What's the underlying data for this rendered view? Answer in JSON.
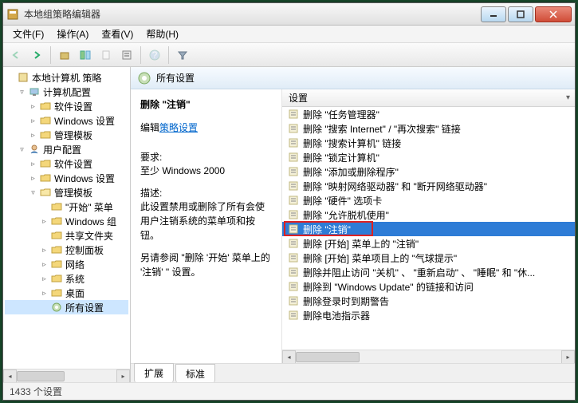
{
  "window": {
    "title": "本地组策略编辑器"
  },
  "menu": {
    "file": "文件(F)",
    "action": "操作(A)",
    "view": "查看(V)",
    "help": "帮助(H)"
  },
  "tree": {
    "root": "本地计算机 策略",
    "computer_config": "计算机配置",
    "software_settings": "软件设置",
    "windows_settings": "Windows 设置",
    "admin_templates": "管理模板",
    "user_config": "用户配置",
    "software_settings2": "软件设置",
    "windows_settings2": "Windows 设置",
    "admin_templates2": "管理模板",
    "start_menu": "\"开始\" 菜单",
    "windows_group": "Windows 组",
    "shared_folders": "共享文件夹",
    "control_panel": "控制面板",
    "network": "网络",
    "system": "系统",
    "desktop": "桌面",
    "all_settings": "所有设置"
  },
  "content": {
    "header": "所有设置",
    "detail_title": "删除 \"注销\"",
    "edit_label": "编辑",
    "edit_link": "策略设置",
    "req_label": "要求:",
    "req_text": "至少 Windows 2000",
    "desc_label": "描述:",
    "desc_text": "此设置禁用或删除了所有会使用户注销系统的菜单项和按钮。",
    "ref_text": "另请参阅 \"删除 '开始' 菜单上的 '注销' \" 设置。"
  },
  "list_header": "设置",
  "list": [
    "删除 \"任务管理器\"",
    "删除 \"搜索 Internet\" / \"再次搜索\" 链接",
    "删除 \"搜索计算机\" 链接",
    "删除 \"锁定计算机\"",
    "删除 \"添加或删除程序\"",
    "删除 \"映射网络驱动器\" 和 \"断开网络驱动器\"",
    "删除 \"硬件\" 选项卡",
    "删除 \"允许脱机使用\"",
    "删除 \"注销\"",
    "删除 [开始] 菜单上的 \"注销\"",
    "删除 [开始] 菜单项目上的 \"气球提示\"",
    "删除并阻止访问 \"关机\" 、 \"重新启动\" 、 \"睡眠\" 和 \"休...",
    "删除到 \"Windows Update\" 的链接和访问",
    "删除登录时到期警告",
    "删除电池指示器"
  ],
  "selected_index": 8,
  "tabs": {
    "extended": "扩展",
    "standard": "标准"
  },
  "status": "1433 个设置"
}
